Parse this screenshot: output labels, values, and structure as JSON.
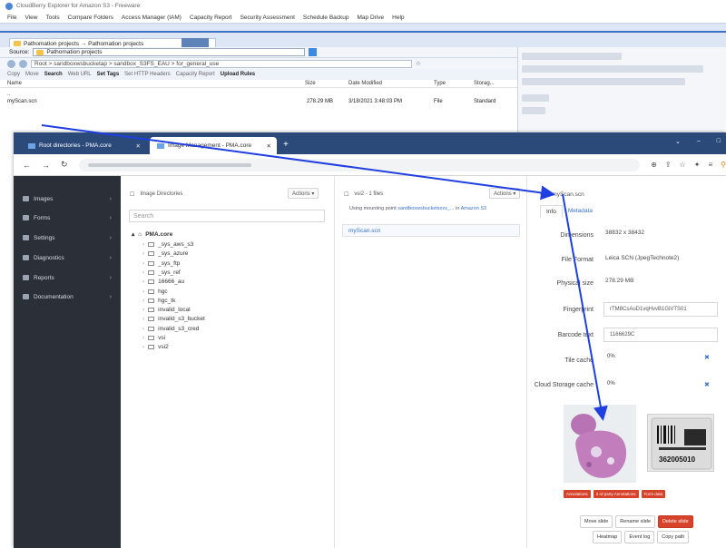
{
  "explorer": {
    "title": "CloudBerry Explorer for Amazon S3 - Freeware",
    "menu": [
      "File",
      "View",
      "Tools",
      "Compare Folders",
      "Access Manager (IAM)",
      "Capacity Report",
      "Security Assessment",
      "Schedule Backup",
      "Map Drive",
      "Help"
    ],
    "tab_label": "Pathomation projects → Pathomation projects",
    "source_label": "Source:",
    "source_value": "Pathomation projects",
    "address": "Root > sandboxwsbucketap > sandbox_S3FS_EAU > for_general_use",
    "toolbar": [
      "Copy",
      "Move",
      "",
      "",
      "Search",
      "",
      "",
      "Web URL",
      "Set Tags",
      "Set HTTP Headers",
      "Capacity Report",
      "Upload Rules"
    ],
    "columns": {
      "name": "Name",
      "size": "Size",
      "date": "Date Modified",
      "type": "Type",
      "storage": "Storag..."
    },
    "rows": [
      {
        "name": "..",
        "size": "",
        "date": "",
        "type": "",
        "storage": ""
      },
      {
        "name": "myScan.scn",
        "size": "278.29 MB",
        "date": "3/18/2021 3:48:03 PM",
        "type": "File",
        "storage": "Standard"
      }
    ]
  },
  "browser": {
    "tab1": "Root directories - PMA.core",
    "tab2": "Image Management - PMA.core",
    "new_tab": "+",
    "controls": [
      "⌄",
      "–",
      "□"
    ]
  },
  "sidebar": {
    "items": [
      {
        "label": "Images"
      },
      {
        "label": "Forms"
      },
      {
        "label": "Settings"
      },
      {
        "label": "Diagnostics"
      },
      {
        "label": "Reports"
      },
      {
        "label": "Documentation"
      }
    ]
  },
  "directories": {
    "header": "Image Directories",
    "actions": "Actions ▾",
    "search_placeholder": "Search",
    "root": "PMA.core",
    "children": [
      "_sys_aws_s3",
      "_sys_azure",
      "_sys_ftp",
      "_sys_ref",
      "16666_au",
      "hgc",
      "hgc_tk",
      "invalid_local",
      "invalid_s3_bucket",
      "invalid_s3_cred",
      "vsi",
      "vsi2"
    ]
  },
  "files": {
    "header": "vsi2 - 1 files",
    "actions": "Actions ▾",
    "notice_prefix": "Using mounting point ",
    "notice_link": "sandboxwsbucketxxxx_...",
    "notice_suffix": " in ",
    "notice_link2": "Amazon S3",
    "item": "myScan.scn"
  },
  "info": {
    "title": "vsi2/myScan.scn",
    "tabs": [
      "Info",
      "Metadata"
    ],
    "dimensions_label": "Dimensions",
    "dimensions_value": "38832 x 38432",
    "format_label": "File Format",
    "format_value": "Leica SCN (JpegTechnote2)",
    "size_label": "Physical size",
    "size_value": "278.29 MB",
    "fingerprint_label": "Fingerprint",
    "fingerprint_value": "rTM8CsAuD1vqHvvB1GiVTS01",
    "barcode_label": "Barcode text",
    "barcode_value": "1166629C",
    "tilecache_label": "Tile cache",
    "tilecache_value": "0%",
    "cloudcache_label": "Cloud Storage cache",
    "cloudcache_value": "0%",
    "clear": "✖",
    "label_text": "362005010",
    "tags": [
      "Annotations",
      "3 rd party Annotations",
      "Form data"
    ],
    "buttons1": [
      "Move slide",
      "Rename slide",
      "Delete slide"
    ],
    "buttons2": [
      "Heatmap",
      "Event log",
      "Copy path"
    ]
  },
  "colors": {
    "arrow": "#1f3fe0",
    "danger": "#d7422b",
    "sidebar": "#2a2f38",
    "tabstrip": "#2b4a7a"
  }
}
